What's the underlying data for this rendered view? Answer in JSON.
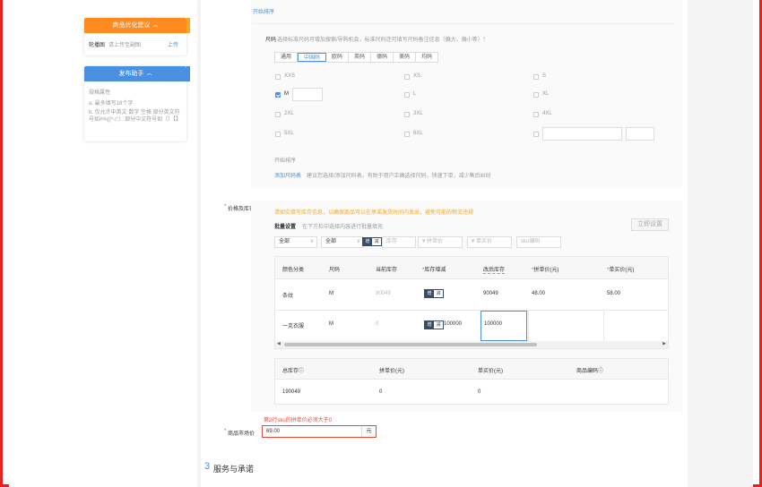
{
  "left_panels": {
    "optimize": {
      "title": "商品优化建议",
      "item_label": "轮播图",
      "item_hint": "请上传至副图",
      "item_action": "上传"
    },
    "assistant": {
      "title": "发布助手",
      "heading": "规格属性",
      "rule_a": "a. 最多填写18个字",
      "rule_b": "b. 仅允许中英文 数字 空格 部分英文符号如#%()*-/:'/.. 部分中文符号如（）【】"
    }
  },
  "size_section": {
    "top_sort_link": "开始排序",
    "label": "尺码",
    "hint": "选择标准尺码可增加搜索/导购机会，标准尺码还可填写尺码备注信息（偏大、偏小等）！",
    "tabs": [
      "通用",
      "中国码",
      "欧码",
      "英码",
      "德码",
      "美码",
      "均码"
    ],
    "active_tab": "中国码",
    "sizes": [
      {
        "label": "XXS",
        "checked": false
      },
      {
        "label": "XS",
        "checked": false
      },
      {
        "label": "S",
        "checked": false
      },
      {
        "label": "M",
        "checked": true
      },
      {
        "label": "L",
        "checked": false
      },
      {
        "label": "XL",
        "checked": false
      },
      {
        "label": "2XL",
        "checked": false
      },
      {
        "label": "3XL",
        "checked": false
      },
      {
        "label": "4XL",
        "checked": false
      },
      {
        "label": "5XL",
        "checked": false
      },
      {
        "label": "6XL",
        "checked": false
      }
    ],
    "bottom_sort": "开始排序",
    "add_size_table": "添加尺码表",
    "add_size_hint": "建议您选择/添加尺码表，有助于用户正确选择尺码，快速下单，减少售后纠纷"
  },
  "price_stock": {
    "label": "价格及库存",
    "warning": "请如实填写库存信息，以确保商品可以在承诺发货时间内发出，避免可能的物流违规",
    "batch_label": "批量设置",
    "batch_hint": "在下方栏中选择内容进行批量填充",
    "apply_all": "立即设置",
    "select_color": "全部",
    "select_size": "全部",
    "inc_label": "增",
    "dec_label": "减",
    "stock_placeholder": "库存",
    "group_price_placeholder": "拼单价",
    "single_price_placeholder": "单买价",
    "sku_code_placeholder": "sku编码",
    "required_mark": "*",
    "columns": [
      "颜色分类",
      "尺码",
      "当前库存",
      "库存增减",
      "改后库存",
      "拼单价(元)",
      "单买价(元)"
    ],
    "rows": [
      {
        "color": "条纹",
        "size": "M",
        "current_stock": "90049",
        "change": "",
        "new_stock": "90049",
        "group_price": "48.00",
        "single_price": "58.00"
      },
      {
        "color": "一克衣服",
        "size": "M",
        "current_stock": "0",
        "change": "100000",
        "new_stock": "100000",
        "group_price": "",
        "single_price": ""
      }
    ],
    "summary_columns": [
      "总库存",
      "拼单价(元)",
      "单买价(元)",
      "商品编码"
    ],
    "summary_values": [
      "190049",
      "0",
      "0",
      ""
    ],
    "error": "第2行sku的拼单价必须大于0"
  },
  "market_price": {
    "label": "商品市场价",
    "value": "69.00",
    "unit": "元"
  },
  "service_section": {
    "number": "3",
    "title": "服务与承诺"
  },
  "colors": {
    "accent_blue": "#4a90e2",
    "orange": "#ff8a1f",
    "error_red": "#e84a3a",
    "frame_red": "#e8201e",
    "stepper_dark": "#3a4c66"
  }
}
